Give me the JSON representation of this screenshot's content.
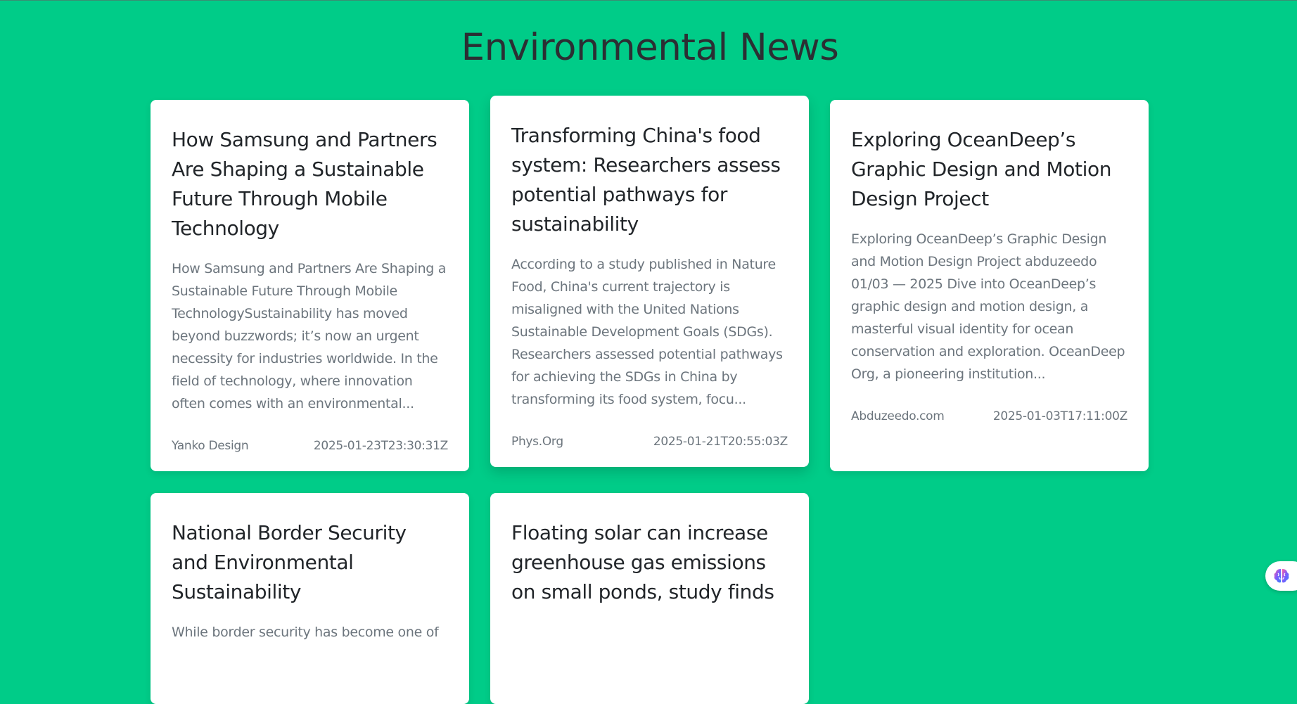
{
  "page": {
    "title": "Environmental News"
  },
  "articles": [
    {
      "title": "How Samsung and Partners Are Shaping a Sustainable Future Through Mobile Technology",
      "summary": "How Samsung and Partners Are Shaping a Sustainable Future Through Mobile TechnologySustainability has moved beyond buzzwords; it’s now an urgent necessity for industries worldwide. In the field of technology, where innovation often comes with an environmental...",
      "source": "Yanko Design",
      "date": "2025-01-23T23:30:31Z"
    },
    {
      "title": "Transforming China's food system: Researchers assess potential pathways for sustainability",
      "summary": "According to a study published in Nature Food, China's current trajectory is misaligned with the United Nations Sustainable Development Goals (SDGs). Researchers assessed potential pathways for achieving the SDGs in China by transforming its food system, focu...",
      "source": "Phys.Org",
      "date": "2025-01-21T20:55:03Z"
    },
    {
      "title": "Exploring OceanDeep’s Graphic Design and Motion Design Project",
      "summary": "Exploring OceanDeep’s Graphic Design and Motion Design Project abduzeedo 01/03 — 2025 Dive into OceanDeep’s graphic design and motion design, a masterful visual identity for ocean conservation and exploration. OceanDeep Org, a pioneering institution...",
      "source": "Abduzeedo.com",
      "date": "2025-01-03T17:11:00Z"
    },
    {
      "title": "National Border Security and Environmental Sustainability",
      "summary": "While border security has become one of",
      "source": "",
      "date": ""
    },
    {
      "title": "Floating solar can increase greenhouse gas emissions on small ponds, study finds",
      "summary": "",
      "source": "",
      "date": ""
    }
  ],
  "widget": {
    "icon": "brain-icon",
    "colors": [
      "#ff5fa2",
      "#7b5cff",
      "#3b82f6"
    ]
  },
  "colors": {
    "background": "#00cc88",
    "card": "#ffffff",
    "title_text": "#212529",
    "muted_text": "#6c757d"
  }
}
